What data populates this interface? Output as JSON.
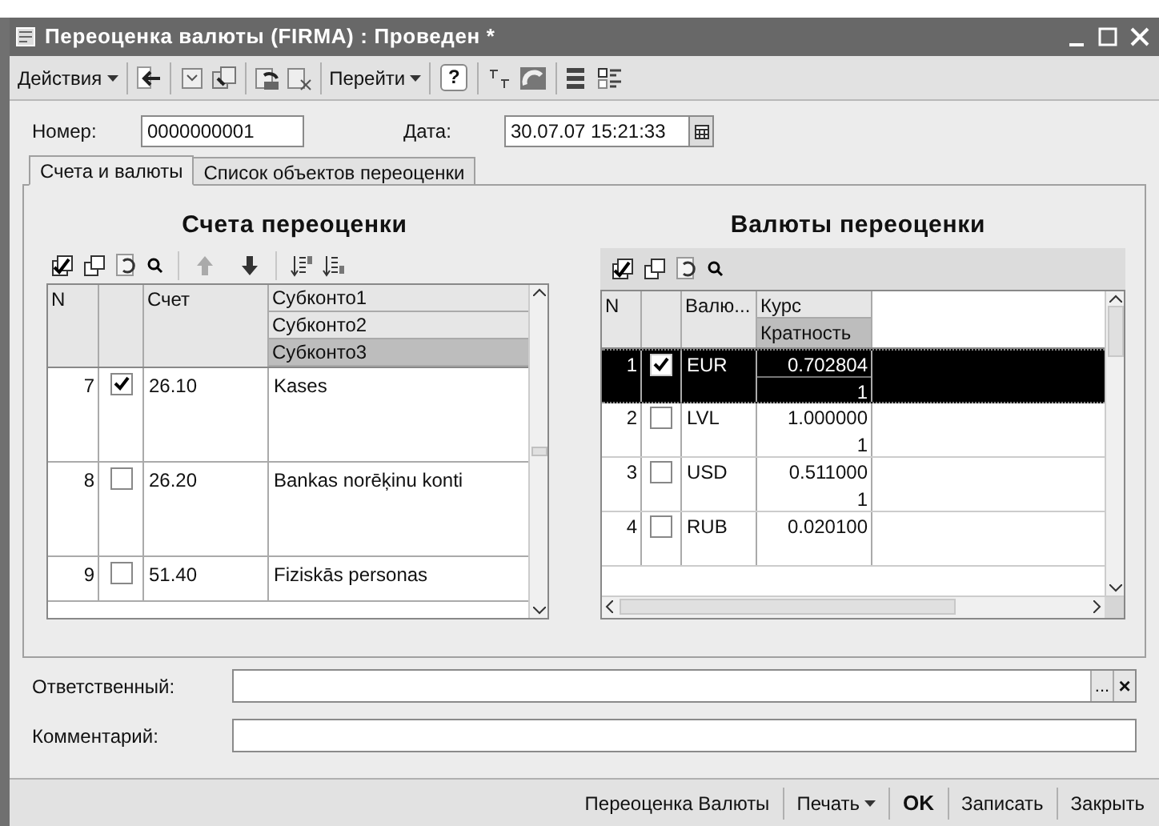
{
  "window": {
    "title": "Переоценка валюты (FIRMA) : Проведен *"
  },
  "toolbar": {
    "actions_menu": "Действия",
    "goto_menu": "Перейти",
    "help": "?"
  },
  "header": {
    "number_label": "Номер:",
    "number": "0000000001",
    "date_label": "Дата:",
    "date": "30.07.07 15:21:33"
  },
  "tabs": [
    {
      "label": "Счета и валюты",
      "selected": true
    },
    {
      "label": "Список объектов переоценки",
      "selected": false
    }
  ],
  "accounts": {
    "title": "Счета переоценки",
    "columns": {
      "n": "N",
      "account": "Счет",
      "subconto": [
        {
          "label": "Субконто1",
          "selected": false
        },
        {
          "label": "Субконто2",
          "selected": false
        },
        {
          "label": "Субконто3",
          "selected": true
        }
      ]
    },
    "rows": [
      {
        "n": "7",
        "checked": true,
        "account": "26.10",
        "subconto": "Kases"
      },
      {
        "n": "8",
        "checked": false,
        "account": "26.20",
        "subconto": "Bankas norēķinu konti"
      },
      {
        "n": "9",
        "checked": false,
        "account": "51.40",
        "subconto": "Fiziskās personas"
      }
    ]
  },
  "currencies": {
    "title": "Валюты переоценки",
    "columns": {
      "n": "N",
      "currency": "Валю...",
      "rate": {
        "label": "Курс",
        "selected": false
      },
      "multiplicity": {
        "label": "Кратность",
        "selected": true
      }
    },
    "rows": [
      {
        "n": "1",
        "checked": true,
        "selected": true,
        "currency": "EUR",
        "rate": "0.702804",
        "multiplicity": "1"
      },
      {
        "n": "2",
        "checked": false,
        "selected": false,
        "currency": "LVL",
        "rate": "1.000000",
        "multiplicity": "1"
      },
      {
        "n": "3",
        "checked": false,
        "selected": false,
        "currency": "USD",
        "rate": "0.511000",
        "multiplicity": "1"
      },
      {
        "n": "4",
        "checked": false,
        "selected": false,
        "currency": "RUB",
        "rate": "0.020100"
      }
    ]
  },
  "fields": {
    "responsible_label": "Ответственный:",
    "ellipsis": "...",
    "clear": "×",
    "comment_label": "Комментарий:"
  },
  "buttons": [
    {
      "label": "Переоценка Валюты",
      "kind": "button"
    },
    {
      "label": "Печать",
      "kind": "menu"
    },
    {
      "label": "OK",
      "kind": "default"
    },
    {
      "label": "Записать",
      "kind": "button"
    },
    {
      "label": "Закрыть",
      "kind": "button"
    }
  ]
}
